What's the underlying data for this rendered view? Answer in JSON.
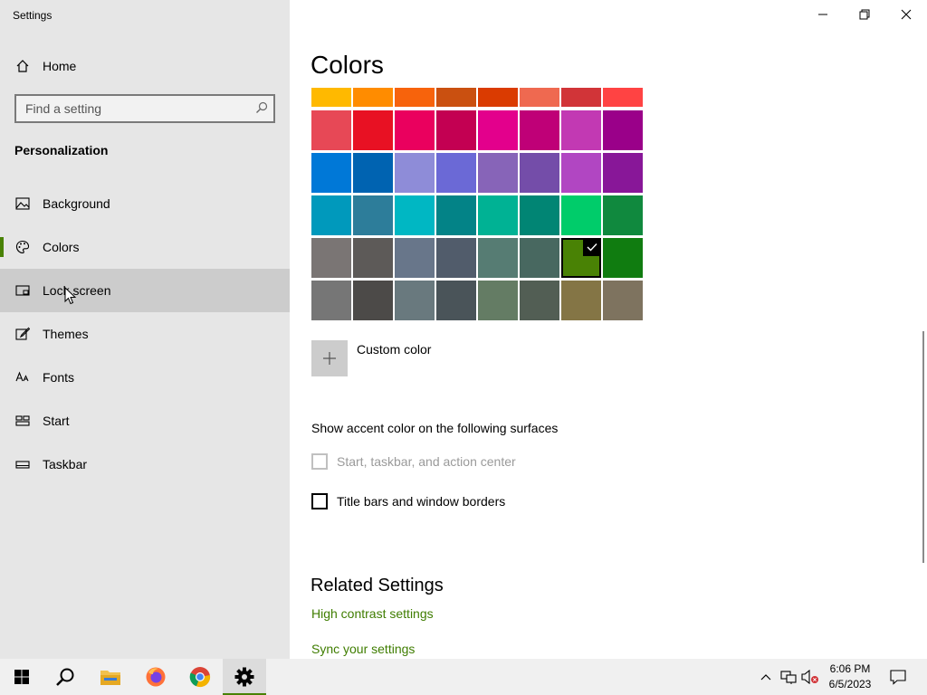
{
  "window": {
    "app_title": "Settings",
    "controls": [
      "minimize-icon",
      "restore-icon",
      "close-icon"
    ]
  },
  "sidebar": {
    "home_label": "Home",
    "search_placeholder": "Find a setting",
    "section_title": "Personalization",
    "items": [
      {
        "label": "Background",
        "icon": "picture-icon"
      },
      {
        "label": "Colors",
        "icon": "palette-icon",
        "selected": true
      },
      {
        "label": "Lock screen",
        "icon": "lock-screen-icon",
        "hovered": true
      },
      {
        "label": "Themes",
        "icon": "brush-icon"
      },
      {
        "label": "Fonts",
        "icon": "font-icon"
      },
      {
        "label": "Start",
        "icon": "start-layout-icon"
      },
      {
        "label": "Taskbar",
        "icon": "taskbar-icon"
      }
    ]
  },
  "main": {
    "title": "Colors",
    "palette": [
      [
        "#FFB900",
        "#FF8C00",
        "#F7630C",
        "#CA5010",
        "#DA3B01",
        "#EF6950",
        "#D13438",
        "#FF4343"
      ],
      [
        "#E74856",
        "#E81123",
        "#EA005E",
        "#C30052",
        "#E3008C",
        "#BF0077",
        "#C239B3",
        "#9A0089"
      ],
      [
        "#0078D7",
        "#0063B1",
        "#8E8CD8",
        "#6B69D6",
        "#8764B8",
        "#744DA9",
        "#B146C2",
        "#881798"
      ],
      [
        "#0099BC",
        "#2D7D9A",
        "#00B7C3",
        "#038387",
        "#00B294",
        "#018574",
        "#00CC6A",
        "#10893E"
      ],
      [
        "#7A7574",
        "#5D5A58",
        "#68768A",
        "#515C6B",
        "#567C73",
        "#486860",
        "#498205",
        "#107C10"
      ],
      [
        "#767676",
        "#4C4A48",
        "#69797E",
        "#4A5459",
        "#647C64",
        "#525E54",
        "#847545",
        "#7E735F"
      ]
    ],
    "selected_color": "#498205",
    "custom_color_label": "Custom color",
    "surfaces_heading": "Show accent color on the following surfaces",
    "checkboxes": [
      {
        "label": "Start, taskbar, and action center",
        "checked": false,
        "disabled": true
      },
      {
        "label": "Title bars and window borders",
        "checked": false,
        "disabled": false
      }
    ],
    "related_heading": "Related Settings",
    "related_links": [
      "High contrast settings",
      "Sync your settings"
    ]
  },
  "taskbar": {
    "apps": [
      "windows-start-icon",
      "search-icon",
      "file-explorer-icon",
      "firefox-icon",
      "chrome-icon",
      "settings-gear-icon"
    ],
    "active_app": "settings-gear-icon",
    "tray_icons": [
      "chevron-up-icon",
      "network-icon",
      "volume-muted-icon",
      "notification-icon"
    ],
    "time": "6:06 PM",
    "date": "6/5/2023"
  },
  "colors": {
    "accent": "#498205",
    "link": "#3F7D00",
    "sidebar_bg": "#E6E6E6",
    "hover_bg": "#CCCCCC"
  }
}
